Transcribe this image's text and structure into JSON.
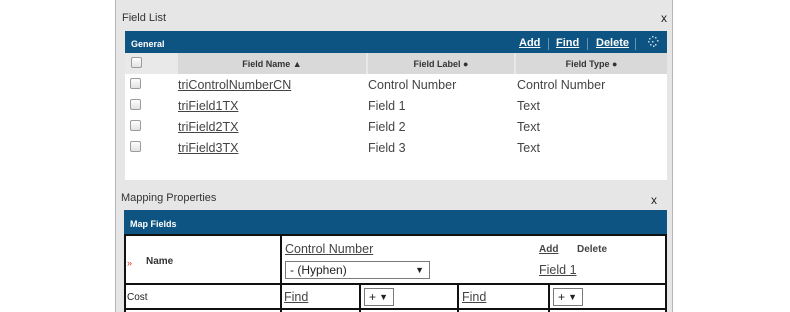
{
  "field_list": {
    "title": "Field List",
    "close": "x",
    "bar_title": "General",
    "actions": {
      "add": "Add",
      "find": "Find",
      "delete": "Delete"
    },
    "columns": {
      "name": "Field Name ▲",
      "label": "Field Label ●",
      "type": "Field Type ●"
    },
    "rows": [
      {
        "name": "triControlNumberCN",
        "label": "Control Number",
        "type": "Control Number"
      },
      {
        "name": "triField1TX",
        "label": "Field 1",
        "type": "Text"
      },
      {
        "name": "triField2TX",
        "label": "Field 2",
        "type": "Text"
      },
      {
        "name": "triField3TX",
        "label": "Field 3",
        "type": "Text"
      }
    ]
  },
  "mapping": {
    "title": "Mapping Properties",
    "close": "x",
    "bar_title": "Map Fields",
    "name_row": {
      "required_marker": "»",
      "label": "Name",
      "field_link": "Control Number",
      "separator_select": "- (Hyphen)",
      "add": "Add",
      "delete": "Delete",
      "second_field_link": "Field 1"
    },
    "cost_row": {
      "label": "Cost",
      "find_1": "Find",
      "op_1": "+",
      "find_2": "Find",
      "op_2": "+"
    }
  },
  "colors": {
    "bar": "#0e5482",
    "panel": "#e6e6e6"
  }
}
